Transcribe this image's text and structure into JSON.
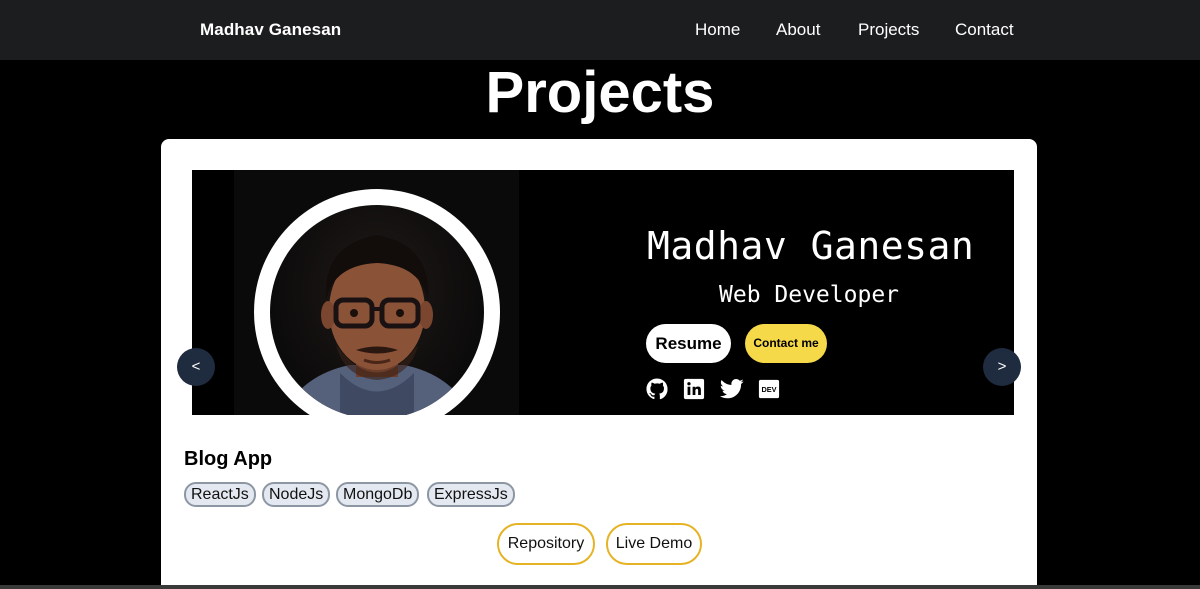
{
  "navbar": {
    "brand": "Madhav Ganesan",
    "links": [
      "Home",
      "About",
      "Projects",
      "Contact"
    ]
  },
  "page": {
    "title": "Projects"
  },
  "carousel": {
    "prev_label": "<",
    "next_label": ">",
    "slide": {
      "name": "Madhav Ganesan",
      "role": "Web Developer",
      "resume_label": "Resume",
      "contact_label": "Contact me",
      "social_icons": [
        "github-icon",
        "linkedin-icon",
        "twitter-icon",
        "dev-icon"
      ],
      "dev_badge_text": "DEV"
    }
  },
  "project": {
    "title": "Blog App",
    "tags": [
      "ReactJs",
      "NodeJs",
      "MongoDb",
      "ExpressJs"
    ],
    "repository_label": "Repository",
    "live_demo_label": "Live Demo"
  },
  "colors": {
    "background": "#000000",
    "navbar": "#1c1d1f",
    "card": "#ffffff",
    "accent_yellow": "#f6d948",
    "link_border": "#e6b325",
    "arrow_bg": "#1f2b3f",
    "tag_bg": "#e4e9f1"
  }
}
